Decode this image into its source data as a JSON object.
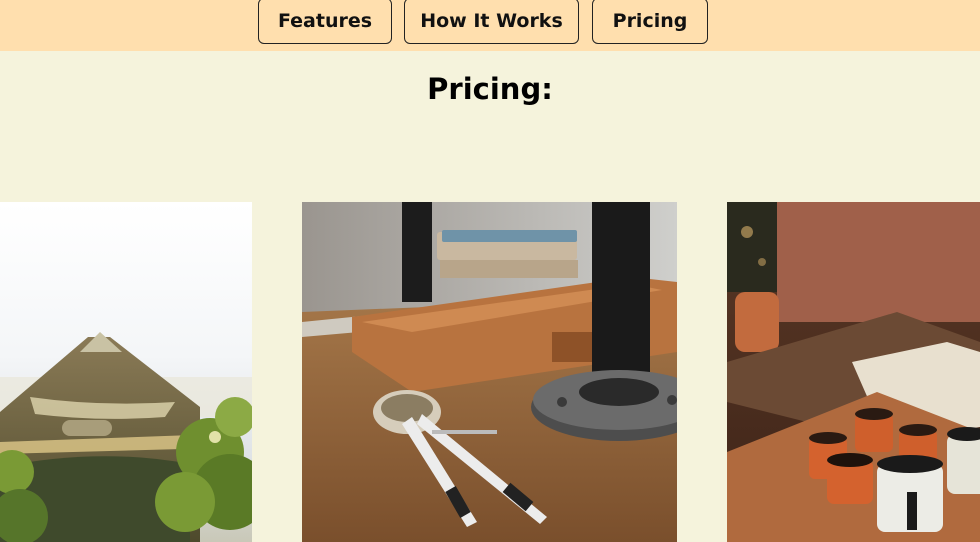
{
  "nav": {
    "items": [
      {
        "label": "Features"
      },
      {
        "label": "How It Works"
      },
      {
        "label": "Pricing"
      }
    ]
  },
  "main": {
    "heading": "Pricing:"
  },
  "gallery": {
    "images": [
      {
        "subject": "canoe on lake with shrubs"
      },
      {
        "subject": "wooden desk with leather notebook, compass and pipe flange"
      },
      {
        "subject": "enamel mugs on wooden table"
      }
    ]
  },
  "colors": {
    "header_bg": "#ffdfae",
    "page_bg": "#f5f3dc",
    "button_border": "#222222"
  }
}
